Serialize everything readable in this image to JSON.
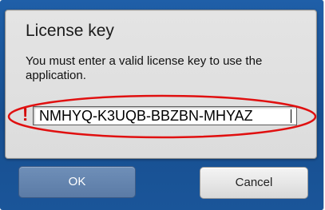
{
  "dialog": {
    "title": "License key",
    "message": "You must enter a valid license key to use the application.",
    "warning_mark": "!",
    "license_key_value": "NMHYQ-K3UQB-BBZBN-MHYAZ",
    "ok_label": "OK",
    "cancel_label": "Cancel"
  },
  "colors": {
    "window_background": "#1b579c",
    "dialog_background": "#e0e0e0",
    "warning": "#d40000",
    "highlight_ellipse": "#e01010",
    "ok_button": "#6584ae"
  },
  "icons": {
    "warning": "exclamation-mark"
  }
}
